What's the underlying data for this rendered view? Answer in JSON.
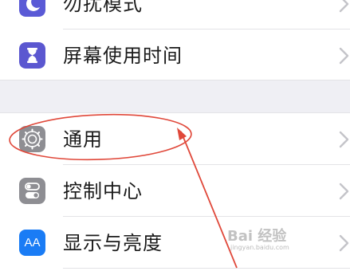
{
  "settings": {
    "rows_top": [
      {
        "label": "勿扰模式",
        "icon": "moon-icon",
        "color": "#5a5ad6"
      },
      {
        "label": "屏幕使用时间",
        "icon": "hourglass-icon",
        "color": "#5b57d0"
      }
    ],
    "rows_bottom": [
      {
        "label": "通用",
        "icon": "gear-icon",
        "color": "#8e8e93"
      },
      {
        "label": "控制中心",
        "icon": "toggles-icon",
        "color": "#8e8e93"
      },
      {
        "label": "显示与亮度",
        "icon": "aa-icon",
        "color": "#1a7cf5",
        "icon_text": "AA"
      }
    ]
  },
  "annotation": {
    "color": "#e0483a"
  },
  "watermark": {
    "text": "Bai 经验",
    "sub": "jingyan.baidu.com"
  }
}
